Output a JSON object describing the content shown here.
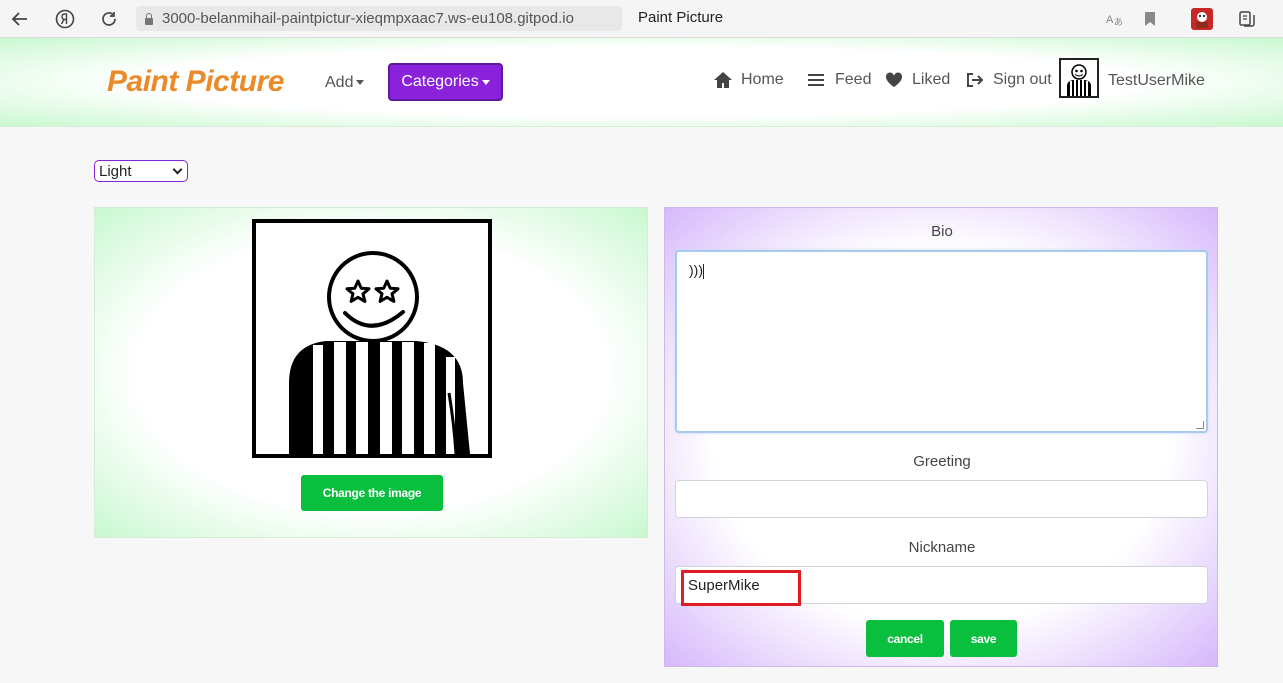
{
  "browser": {
    "url": "3000-belanmihail-paintpictur-xieqmpxaac7.ws-eu108.gitpod.io",
    "tab_title": "Paint Picture"
  },
  "navbar": {
    "brand": "Paint Picture",
    "add_label": "Add",
    "categories_label": "Categories",
    "home_label": "Home",
    "feed_label": "Feed",
    "liked_label": "Liked",
    "signout_label": "Sign out",
    "username": "TestUserMike"
  },
  "theme": {
    "selected": "Light"
  },
  "profile": {
    "change_image_label": "Change the image"
  },
  "form": {
    "bio_label": "Bio",
    "bio_value": ")))",
    "greeting_label": "Greeting",
    "greeting_value": "",
    "nickname_label": "Nickname",
    "nickname_value": "SuperMike",
    "cancel_label": "cancel",
    "save_label": "save"
  },
  "colors": {
    "brand": "#ea8a28",
    "categories_button": "#8a22dc",
    "action_green": "#0abf3e",
    "highlight": "#e01b24"
  }
}
